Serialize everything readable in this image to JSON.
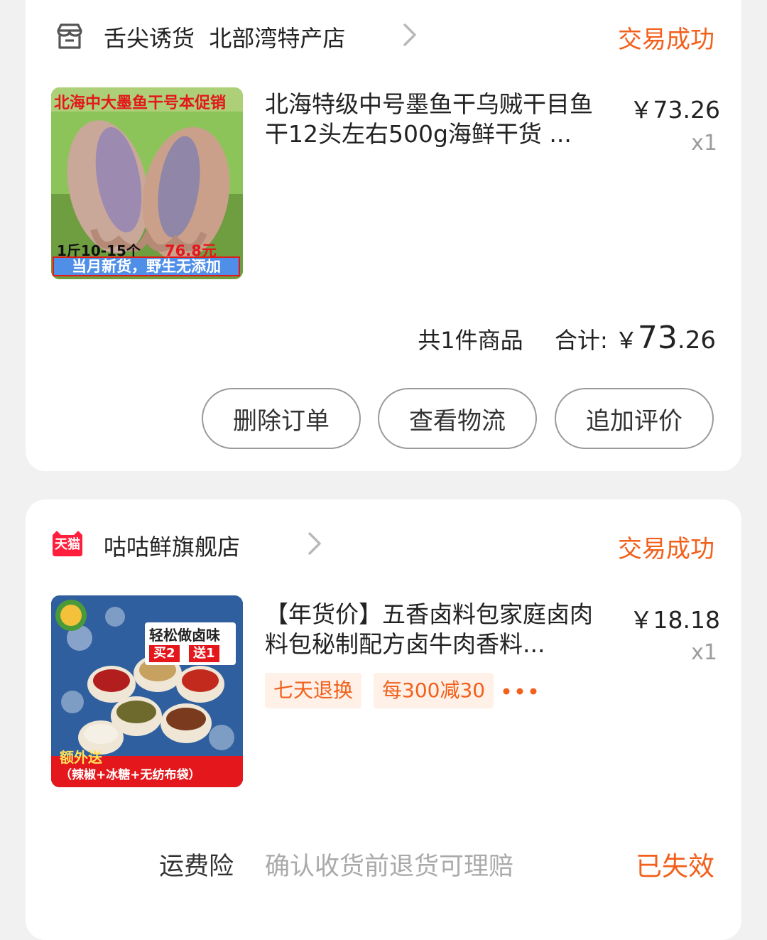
{
  "orders": [
    {
      "shop": {
        "name": "舌尖诱货  北部湾特产店",
        "icon": "store-icon"
      },
      "status": "交易成功",
      "item": {
        "title": "北海特级中号墨鱼干乌贼干目鱼干12头左右500g海鲜干货 ...",
        "price": "￥73.26",
        "qty": "x1",
        "image": {
          "banner": "北海中大墨鱼干号本促销",
          "spec": "1斤10-15个",
          "spec_price": "76.8元",
          "footer": "当月新货，野生无添加"
        }
      },
      "summary": {
        "count": "共1件商品",
        "total_label": "合计:",
        "currency": "￥",
        "total_int": "73",
        "total_dec": ".26"
      },
      "actions": [
        "删除订单",
        "查看物流",
        "追加评价"
      ]
    },
    {
      "shop": {
        "name": "咕咕鲜旗舰店",
        "badge": "天猫",
        "icon": "tmall-icon"
      },
      "status": "交易成功",
      "item": {
        "title": "【年货价】五香卤料包家庭卤肉料包秘制配方卤牛肉香料...",
        "price": "￥18.18",
        "qty": "x1",
        "tags": [
          "七天退换",
          "每300减30"
        ],
        "image": {
          "headline": "轻松做卤味",
          "promo_buy": "买2",
          "promo_get": "送1",
          "extra_title": "额外送",
          "extra_detail": "（辣椒+冰糖+无纺布袋）"
        }
      },
      "insurance": {
        "label": "运费险",
        "desc": "确认收货前退货可理赔",
        "status": "已失效"
      }
    }
  ],
  "colors": {
    "accent": "#f2601b",
    "background": "#f1f1f1",
    "card": "#ffffff",
    "tmall_red": "#ff1f3d"
  }
}
